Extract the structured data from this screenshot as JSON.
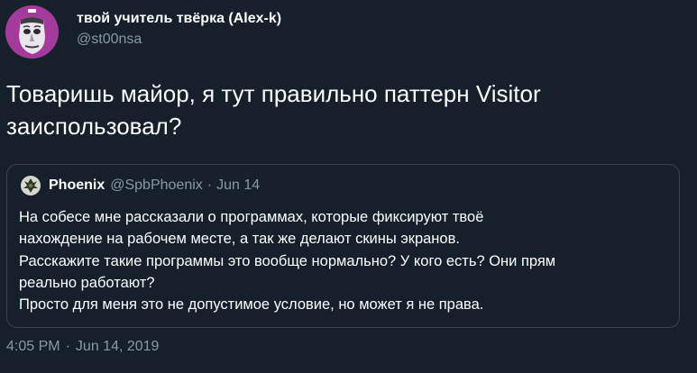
{
  "author": {
    "display_name": "твой учитель твёрка (Alex-k)",
    "handle": "@st00nsa",
    "avatar_icon": "profile-avatar"
  },
  "tweet": {
    "text_lines": [
      "Товаришь майор, я тут правильно паттерн Visitor",
      "заиспользовал?"
    ],
    "time": "4:05 PM",
    "separator": "·",
    "date": "Jun 14, 2019"
  },
  "quoted_tweet": {
    "display_name": "Phoenix",
    "handle": "@SpbPhoenix",
    "separator": "·",
    "date": "Jun 14",
    "avatar_icon": "phoenix-avatar",
    "body_lines": [
      "На собесе мне рассказали о программах, которые фиксируют твоё",
      "нахождение на рабочем месте, а так же делают скины экранов.",
      "Расскажите такие программы это вообще нормально? У кого есть? Они прям",
      "реально работают?",
      "Просто для меня это не допустимое условие, но может я не права."
    ]
  },
  "colors": {
    "background": "#15202b",
    "secondary_text": "#8899a6",
    "border": "#38444d",
    "primary_text": "#ffffff"
  }
}
